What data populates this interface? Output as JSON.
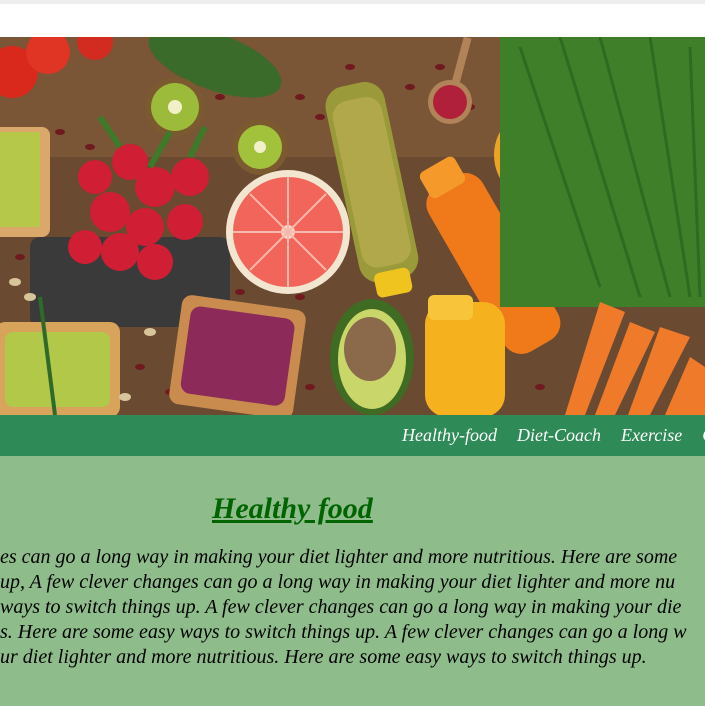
{
  "nav": {
    "items": [
      {
        "label": "Healthy-food"
      },
      {
        "label": "Diet-Coach"
      },
      {
        "label": "Exercise"
      },
      {
        "label": "C"
      }
    ]
  },
  "hero": {
    "description": "Colorful healthy food spread"
  },
  "article": {
    "heading": "Healthy food",
    "lines": [
      "es can go a long way in making your diet lighter and more nutritious. Here are some",
      "up, A few clever changes can go a long way in making your diet lighter and more nu",
      "ways to switch things up. A few clever changes can go a long way in making your die",
      "s. Here are some easy ways to switch things up. A few clever changes can go a long w",
      "ur diet lighter and more nutritious. Here are some easy ways to switch things up."
    ]
  },
  "colors": {
    "nav_bg": "#2e8b57",
    "content_bg": "#8fbc8b",
    "heading": "#006400"
  }
}
